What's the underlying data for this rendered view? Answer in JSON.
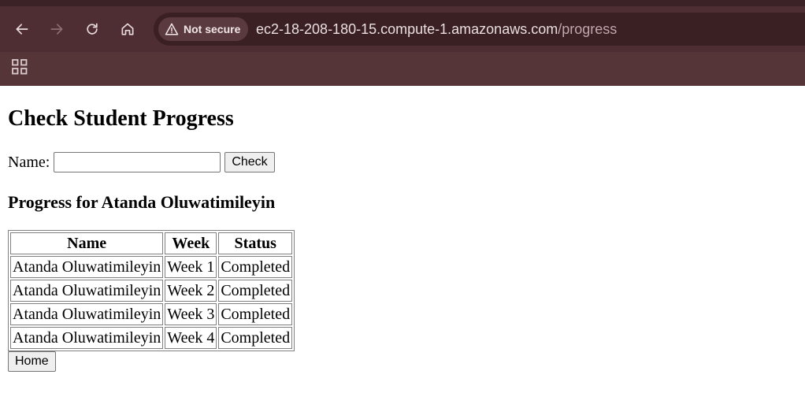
{
  "browser": {
    "security_label": "Not secure",
    "url_host": "ec2-18-208-180-15.compute-1.amazonaws.com",
    "url_path": "/progress"
  },
  "page": {
    "title": "Check Student Progress",
    "form": {
      "name_label": "Name:",
      "name_value": "",
      "check_label": "Check"
    },
    "results_heading": "Progress for Atanda Oluwatimileyin",
    "table": {
      "headers": [
        "Name",
        "Week",
        "Status"
      ],
      "rows": [
        [
          "Atanda Oluwatimileyin",
          "Week 1",
          "Completed"
        ],
        [
          "Atanda Oluwatimileyin",
          "Week 2",
          "Completed"
        ],
        [
          "Atanda Oluwatimileyin",
          "Week 3",
          "Completed"
        ],
        [
          "Atanda Oluwatimileyin",
          "Week 4",
          "Completed"
        ]
      ]
    },
    "home_label": "Home"
  },
  "colors": {
    "chrome_bg": "#4f2e33",
    "omnibox_bg": "#3a1f23"
  }
}
